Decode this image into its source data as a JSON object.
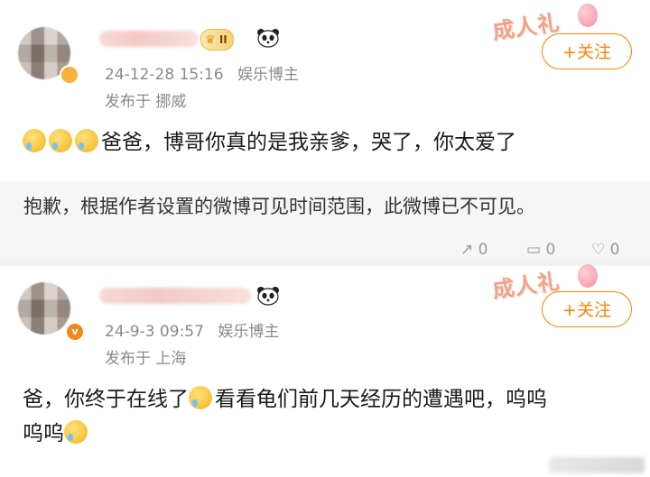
{
  "comments": [
    {
      "date": "24-12-28 15:16",
      "role": "娱乐博主",
      "location": "发布于 挪威",
      "follow_label": "+关注",
      "badge_level": "II",
      "decoration": "成人礼",
      "text": "爸爸，博哥你真的是我亲爹，哭了，你太爱了",
      "emoji_names": [
        "crying-emoji",
        "crying-emoji",
        "crying-emoji"
      ]
    },
    {
      "date": "24-9-3 09:57",
      "role": "娱乐博主",
      "location": "发布于 上海",
      "follow_label": "+关注",
      "avatar_badge": "v",
      "decoration": "成人礼",
      "text_line1_a": "爸，你终于在线了",
      "text_line1_b": "看看龟们前几天经历的遭遇吧，呜呜",
      "text_line2": "呜呜",
      "emoji_names": [
        "crying-emoji",
        "crying-emoji"
      ]
    }
  ],
  "notice": "抱歉，根据作者设置的微博可见时间范围，此微博已不可见。",
  "stats": {
    "repost": "0",
    "comment": "0",
    "like": "0"
  },
  "colors": {
    "accent": "#ff8200",
    "meta": "#8a8a8a",
    "notice_bg": "#f6f6f6"
  }
}
